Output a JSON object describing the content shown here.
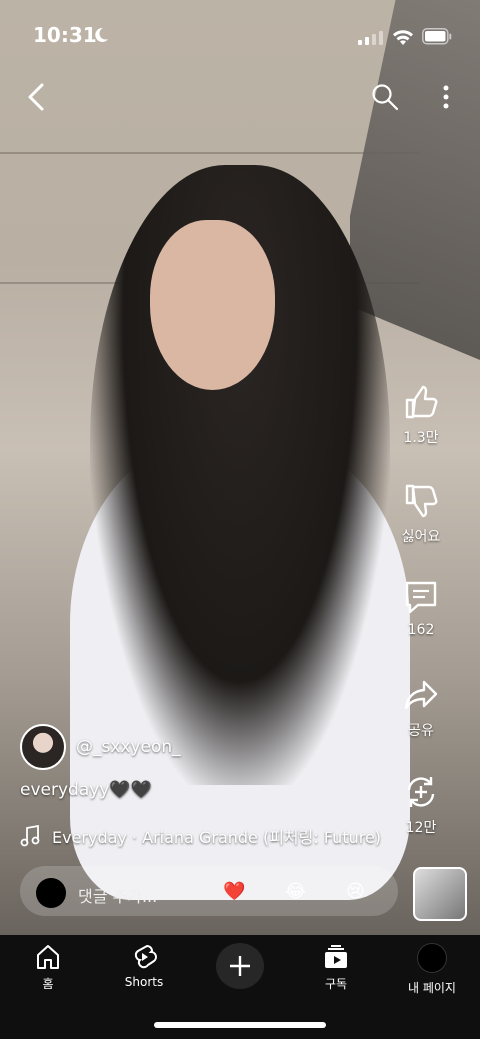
{
  "status_bar": {
    "time": "10:31"
  },
  "actions": {
    "like_count": "1.3만",
    "dislike_label": "싫어요",
    "comment_count": "162",
    "share_label": "공유",
    "remix_count": "12만"
  },
  "video": {
    "channel_handle": "@_sxxyeon_",
    "caption": "everydayy🖤🖤",
    "music": "Everyday · Ariana Grande (피처링: Future)"
  },
  "comment_bar": {
    "placeholder": "댓글 추가...",
    "emojis": [
      "❤️",
      "😂",
      "😢"
    ]
  },
  "bottom_nav": {
    "home": "홈",
    "shorts": "Shorts",
    "subscriptions": "구독",
    "my_page": "내 페이지"
  },
  "colors": {
    "nav_bg": "#0f0f0f",
    "text": "#ffffff",
    "comment_bar_bg": "rgba(255,255,255,0.18)"
  }
}
